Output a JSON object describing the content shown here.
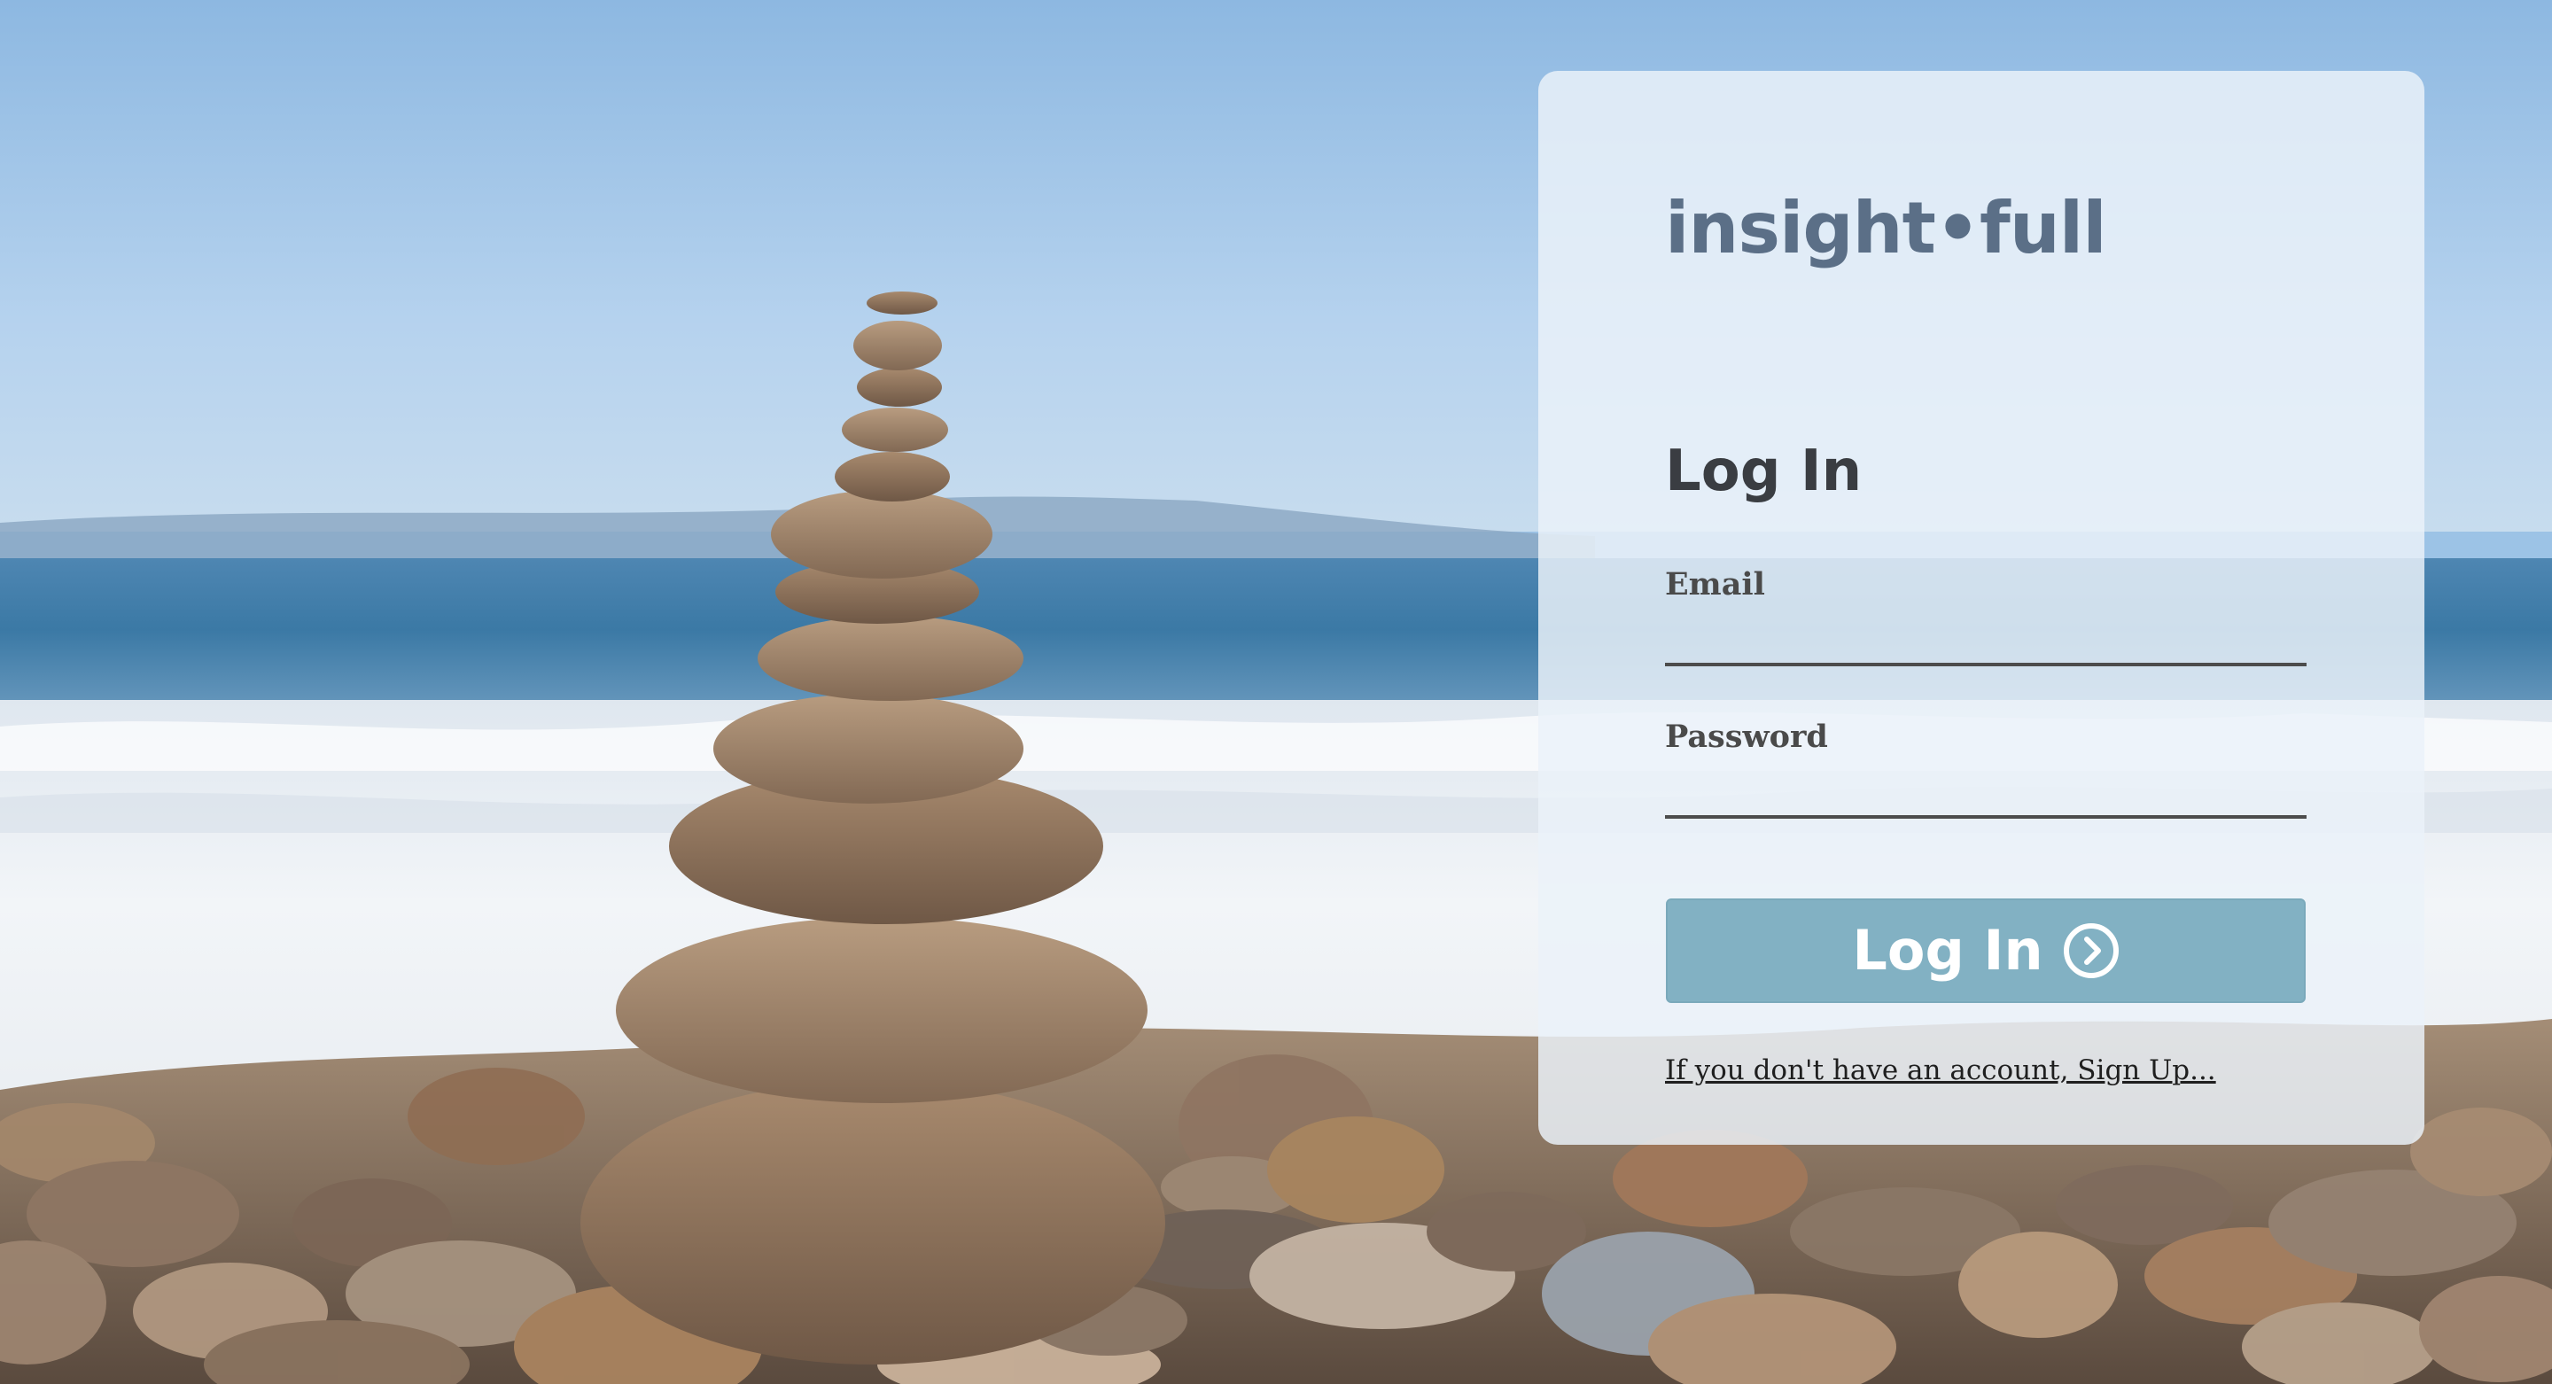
{
  "brand": {
    "logo_text": "insight•full"
  },
  "login_form": {
    "title": "Log In",
    "email_label": "Email",
    "email_value": "",
    "password_label": "Password",
    "password_value": "",
    "submit_label": "Log In",
    "submit_icon": "chevron-right-circle-icon",
    "signup_text": "If you don't have an account, Sign Up..."
  },
  "colors": {
    "brand_text": "#5b6f87",
    "button_background": "#82b1c3",
    "card_background": "rgba(235, 242, 249, 0.84)"
  }
}
